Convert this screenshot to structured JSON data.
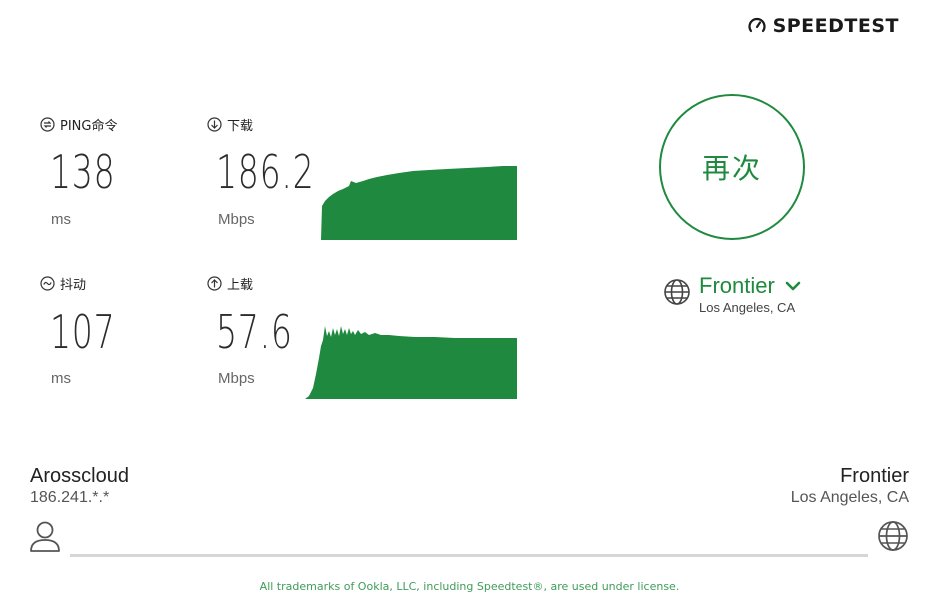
{
  "logo": {
    "text": "SPEEDTEST",
    "icon": "speedometer-icon"
  },
  "metrics": {
    "ping": {
      "label": "PING命令",
      "value": "138",
      "unit": "ms",
      "icon": "ping-icon"
    },
    "jitter": {
      "label": "抖动",
      "value": "107",
      "unit": "ms",
      "icon": "jitter-icon"
    },
    "download": {
      "label": "下载",
      "value": "186.2",
      "unit": "Mbps",
      "icon": "download-arrow-icon"
    },
    "upload": {
      "label": "上载",
      "value": "57.6",
      "unit": "Mbps",
      "icon": "upload-arrow-icon"
    }
  },
  "again_button": {
    "label": "再次"
  },
  "server": {
    "name": "Frontier",
    "location": "Los Angeles, CA",
    "icon": "globe-icon",
    "dropdown_icon": "chevron-down-icon"
  },
  "client": {
    "isp": "Arosscloud",
    "ip": "186.241.*.*",
    "icon": "user-icon"
  },
  "remote": {
    "isp": "Frontier",
    "location": "Los Angeles, CA",
    "icon": "globe-icon"
  },
  "footer": {
    "text": "All trademarks of Ookla, LLC, including Speedtest®, are used under license."
  },
  "colors": {
    "accent": "#1f8a3f",
    "line": "#d6d6d6",
    "text": "#333333"
  }
}
